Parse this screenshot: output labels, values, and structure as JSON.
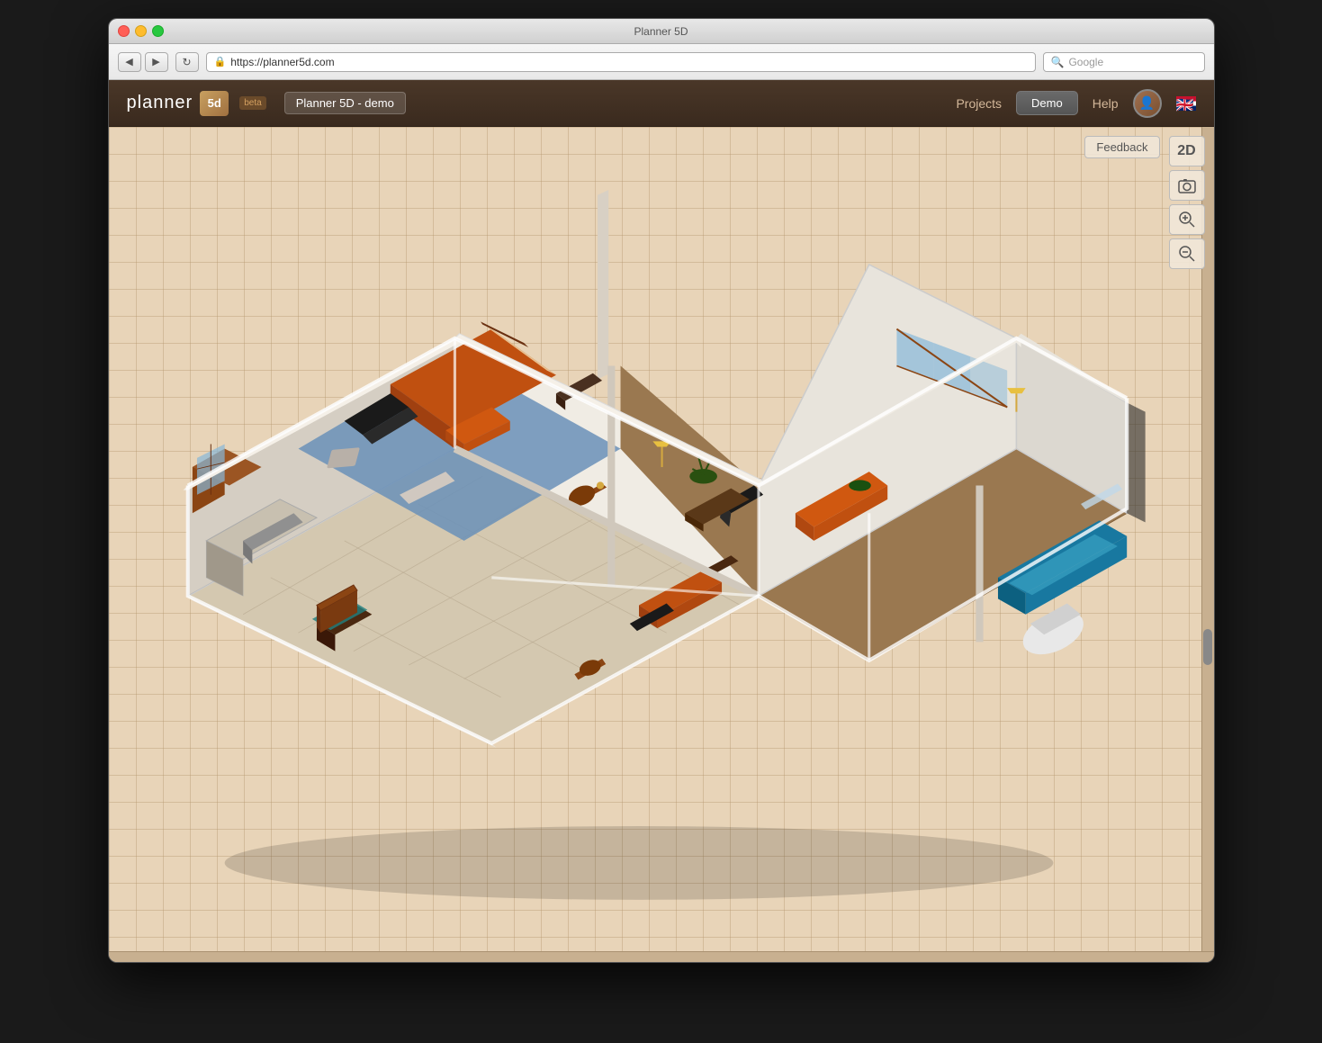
{
  "window": {
    "title": "Planner 5D",
    "close_label": "×",
    "min_label": "–",
    "max_label": "+"
  },
  "browser": {
    "url": "https://planner5d.com",
    "search_placeholder": "Google",
    "back_icon": "◀",
    "forward_icon": "▶",
    "reload_icon": "↻"
  },
  "header": {
    "logo_text": "planner",
    "logo_5d": "5d",
    "beta_label": "beta",
    "project_name": "Planner 5D - demo",
    "nav_projects": "Projects",
    "nav_demo": "Demo",
    "nav_help": "Help"
  },
  "toolbar": {
    "feedback_label": "Feedback",
    "view_2d_label": "2D",
    "screenshot_icon": "📷",
    "zoom_in_icon": "🔍+",
    "zoom_out_icon": "🔍-"
  },
  "canvas": {
    "background_color": "#e8d4b8",
    "grid_color": "rgba(180,150,110,0.4)"
  }
}
